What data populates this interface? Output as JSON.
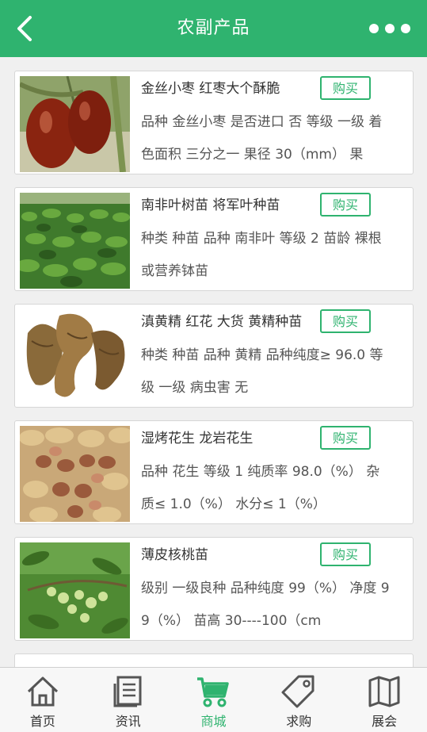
{
  "header": {
    "title": "农副产品"
  },
  "products": [
    {
      "name": "金丝小枣 红枣大个酥脆",
      "buy_label": "购买",
      "description": "品种 金丝小枣 是否进口 否 等级 一级 着色面积 三分之一 果径 30（mm） 果"
    },
    {
      "name": "南非叶树苗 将军叶种苗",
      "buy_label": "购买",
      "description": "种类 种苗 品种 南非叶 等级 2 苗龄 裸根或营养钵苗"
    },
    {
      "name": "滇黄精 红花 大货 黄精种苗",
      "buy_label": "购买",
      "description": "种类 种苗 品种 黄精 品种纯度≥ 96.0 等级 一级 病虫害 无"
    },
    {
      "name": "湿烤花生 龙岩花生",
      "buy_label": "购买",
      "description": "品种 花生 等级 1 纯质率 98.0（%） 杂质≤ 1.0（%） 水分≤ 1（%）"
    },
    {
      "name": "薄皮核桃苗",
      "buy_label": "购买",
      "description": "级别 一级良种 品种纯度 99（%） 净度 99（%） 苗高 30----100（cm"
    }
  ],
  "tabs": [
    {
      "label": "首页",
      "icon": "home-icon"
    },
    {
      "label": "资讯",
      "icon": "news-icon"
    },
    {
      "label": "商城",
      "icon": "cart-icon",
      "active": true
    },
    {
      "label": "求购",
      "icon": "tag-icon"
    },
    {
      "label": "展会",
      "icon": "map-icon"
    }
  ],
  "colors": {
    "accent": "#2fb36f",
    "background": "#f0f0f0"
  }
}
